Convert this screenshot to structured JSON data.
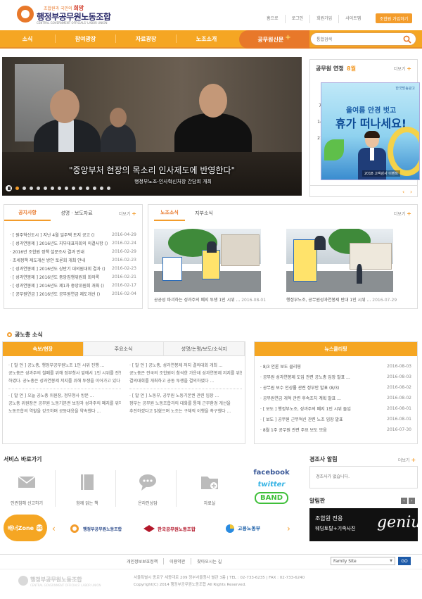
{
  "header": {
    "logo_slogan": "조합원과 국민의",
    "logo_slogan_accent": "희망",
    "logo_name": "행정부공무원노동조합",
    "logo_eng": "CENTRAL GOVERNMENT OFFICIALS' LABOR UNION",
    "util_links": [
      "홈으로",
      "로그인",
      "회원가입",
      "사이트맵"
    ],
    "member_button": "조합원 가입하기"
  },
  "gnb": {
    "menus": [
      "소식",
      "참여광장",
      "자료광장",
      "노조소개"
    ],
    "special": "공무원신문",
    "search_placeholder": "통합검색"
  },
  "hero": {
    "caption_main": "\"중앙부처 현장의 목소리 인사제도에 반영한다\"",
    "caption_sub": "행정부노조-인사혁신처장 간담회 개최",
    "slide_count": 14,
    "active_slide": 1
  },
  "calendar": {
    "title": "공무원 연정",
    "month": "8월",
    "more": "더보기",
    "weekdays": [
      "일",
      "월",
      "화",
      "수",
      "목",
      "금",
      "토"
    ],
    "week_rows": [
      [
        "",
        "",
        "",
        "",
        "",
        "",
        ""
      ],
      [
        "7",
        "8",
        "9",
        "",
        "",
        "",
        ""
      ],
      [
        "14",
        "",
        "",
        "",
        "",
        "",
        ""
      ],
      [
        "21",
        "",
        "",
        "",
        "",
        "",
        ""
      ]
    ],
    "ad": {
      "brand": "한국방송광고",
      "line1": "올여름 안경 벗고",
      "line2": "휴가 떠나세요!",
      "footer": "2018 고객감사 이벤트"
    }
  },
  "notice": {
    "tabs": [
      "공지사항",
      "성명 · 보도자료"
    ],
    "more": "더보기",
    "items": [
      {
        "title": "· [ 원주혁신도시 ] 지난 4월 일주택 토지 공고 ()",
        "date": "2016-04-29"
      },
      {
        "title": "· [ 성과연봉제 ] 2016년도 지부대표자회의 의결사항 ()",
        "date": "2016-02-24"
      },
      {
        "title": "· 2016년 조합원 정책 설문조사 결과 안내",
        "date": "2016-02-29"
      },
      {
        "title": "· 조세정책 제도개선 방안 토론회 개최 안내",
        "date": "2016-02-23"
      },
      {
        "title": "· [ 성과연봉제 ] 2016년도 상반기 대의원대회 결과 ()",
        "date": "2016-02-23"
      },
      {
        "title": "· [ 성과연봉제 ] 2016년도 중앙집행위원회 회의록",
        "date": "2016-02-21"
      },
      {
        "title": "· [ 성과연봉제 ] 2016년도 제1차 중앙위원회 개최 ()",
        "date": "2016-02-17"
      },
      {
        "title": "· [ 공무원연금 ] 2016년도 공무원연금 제도개선 ()",
        "date": "2016-02-04"
      }
    ]
  },
  "union_photos": {
    "tabs": [
      "노조소식",
      "지부소식"
    ],
    "more": "더보기",
    "items": [
      {
        "caption": "공공성 파괴하는 성과주의 폐지 투쟁 1인 시위 ...",
        "date": "2016-08-01"
      },
      {
        "caption": "행정부노조, 공무원성과연봉제 반대 1인 시위 ...",
        "date": "2016-07-29"
      }
    ]
  },
  "union_news": {
    "title": "공노총 소식",
    "tabs": [
      "속보/현장",
      "주요소식",
      "성명/논평/보도/소식지"
    ],
    "col1": {
      "block1": [
        "· [ 발 언 ] 공노총, 행정부공무원노조 1인 시위 진행 ...",
        "공노총은 성과주의 철폐를 위해 정부청사 앞에서 1인 시위를 진행",
        "하였다. 공노총은 성과연봉제 저지를 위해 투쟁을 이어가고 있다 ..."
      ],
      "block2": [
        "· [ 발 언 ] 오늘 공노총 위원장, 정부청사 방문 ...",
        "공노총 위원장은 공무원 노동기본권 보장과 성과주의 폐지를 위해",
        "노동조합의 역할을 강조하며 공동대응을 약속했다 ..."
      ]
    },
    "col2": {
      "block1": [
        "· [ 발 언 ] 공노총, 성과연봉제 저지 결의대회 개최 ...",
        "공노총은 전국의 조합원이 참석한 가운데 성과연봉제 저지를 위한",
        "결의대회를 개최하고 공동 투쟁을 결의하였다 ..."
      ],
      "block2": [
        "· [ 발 언 ] 노동부, 공무원 노동기본권 관련 입장 ...",
        "정부는 공무원 노동조합과의 대화를 통해 근무환경 개선을",
        "추진하겠다고 밝혔으며 노조는 구체적 이행을 촉구했다 ..."
      ]
    }
  },
  "issues": {
    "title": "뉴스클리핑",
    "items": [
      {
        "title": "· 8/3 언론 보도 클리핑",
        "date": "2016-08-03"
      },
      {
        "title": "· 공무원 성과연봉제 도입 관련 공노총 입장 발표 ...",
        "date": "2016-08-03"
      },
      {
        "title": "· 공무원 보수 인상률 관련 정부안 발표 (8/3)",
        "date": "2016-08-02"
      },
      {
        "title": "· 공무원연금 개혁 관련 후속조치 계획 발표 ...",
        "date": "2016-08-02"
      },
      {
        "title": "· [ 보도 ] 행정부노조, 성과주의 폐지 1인 시위 돌입",
        "date": "2016-08-01"
      },
      {
        "title": "· [ 보도 ] 공무원 근무혁신 관련 노조 입장 발표",
        "date": "2016-08-01"
      },
      {
        "title": "· 8월 1주 공무원 관련 주요 보도 모음",
        "date": "2016-07-30"
      }
    ]
  },
  "services": {
    "title": "서비스 바로가기",
    "items": [
      "인권침해 신고하기",
      "함께 읽는 책",
      "온라인상담",
      "자료실"
    ],
    "social": [
      "facebook",
      "twitter",
      "BAND"
    ]
  },
  "law": {
    "title": "경조사 알림",
    "more": "더보기",
    "empty": "경조사가 없습니다."
  },
  "board": {
    "title": "알림판",
    "line1": "조합원 전용",
    "line2": "웨딩토탈+기족사진",
    "brand": "genius"
  },
  "banner_zone": {
    "label": "배너Zone",
    "go": "GO",
    "items": [
      "행정부공무원노동조합",
      "한국공무원노동조합",
      "고용노동부"
    ]
  },
  "footer": {
    "links": [
      "개인정보보호정책",
      "이용약관",
      "찾아오시는 길"
    ],
    "family_site": "Family Site",
    "go": "GO",
    "logo_name": "행정부공무원노동조합",
    "logo_eng": "CENTRAL GOVERNMENT OFFICIALS' LABOR UNION",
    "address": "서울특별시 종로구 세종대로 209 정부서울청사 별관 3층 | TEL : 02-733-6235 | FAX : 02-733-6240",
    "copyright": "Copyright(C) 2014 행정부공무원노동조합 All Rights Reserved."
  },
  "colors": {
    "accent": "#f5a623",
    "accent_dark": "#e8782a",
    "brand_navy": "#2b2b6b"
  }
}
